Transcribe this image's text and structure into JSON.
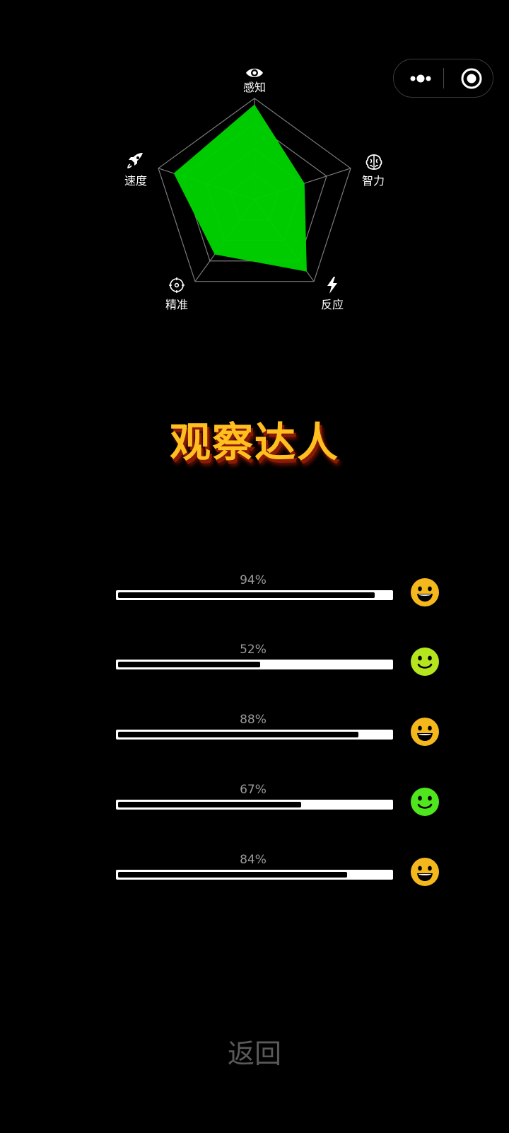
{
  "menu": {
    "more_icon": "more-dots-icon",
    "close_icon": "target-close-icon"
  },
  "radar": {
    "type": "radar",
    "axes": [
      {
        "label": "感知",
        "icon": "eye-icon",
        "value": 0.94
      },
      {
        "label": "智力",
        "icon": "brain-icon",
        "value": 0.52
      },
      {
        "label": "反应",
        "icon": "lightning-icon",
        "value": 0.88
      },
      {
        "label": "精准",
        "icon": "crosshair-icon",
        "value": 0.67
      },
      {
        "label": "速度",
        "icon": "rocket-icon",
        "value": 0.84
      }
    ],
    "fill_color": "#00d100",
    "grid_color": "#7a7a7a"
  },
  "title": "观察达人",
  "title_color": "#ffbf1f",
  "progress": [
    {
      "percent_text": "94%",
      "value": 0.94,
      "face": "grin-face-icon",
      "face_color": "#f5b81c"
    },
    {
      "percent_text": "52%",
      "value": 0.52,
      "face": "smile-face-icon",
      "face_color": "#b5e61d"
    },
    {
      "percent_text": "88%",
      "value": 0.88,
      "face": "grin-face-icon",
      "face_color": "#f5b81c"
    },
    {
      "percent_text": "67%",
      "value": 0.67,
      "face": "smile-face-icon",
      "face_color": "#4fe61d"
    },
    {
      "percent_text": "84%",
      "value": 0.84,
      "face": "grin-face-icon",
      "face_color": "#f5b81c"
    }
  ],
  "back_label": "返回"
}
